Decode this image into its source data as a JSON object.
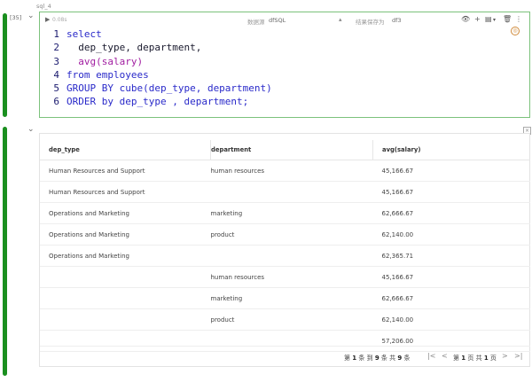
{
  "cell": {
    "label": "sql_4",
    "exec_count": "[35]",
    "duration": "0.08s",
    "datasource_label": "数据源",
    "datasource_value": "dfSQL",
    "save_label": "结果保存为",
    "save_value": "df3"
  },
  "code": {
    "lines": [
      {
        "num": "1",
        "text": "select"
      },
      {
        "num": "2",
        "text": "  dep_type, department,"
      },
      {
        "num": "3",
        "text": "  avg(salary)"
      },
      {
        "num": "4",
        "text": "from employees"
      },
      {
        "num": "5",
        "text": "GROUP BY cube(dep_type, department)"
      },
      {
        "num": "6",
        "text": "ORDER by dep_type , department;"
      }
    ]
  },
  "table": {
    "headers": [
      "dep_type",
      "department",
      "avg(salary)"
    ],
    "rows": [
      [
        "Human Resources and Support",
        "human resources",
        "45,166.67"
      ],
      [
        "Human Resources and Support",
        "",
        "45,166.67"
      ],
      [
        "Operations and Marketing",
        "marketing",
        "62,666.67"
      ],
      [
        "Operations and Marketing",
        "product",
        "62,140.00"
      ],
      [
        "Operations and Marketing",
        "",
        "62,365.71"
      ],
      [
        "",
        "human resources",
        "45,166.67"
      ],
      [
        "",
        "marketing",
        "62,666.67"
      ],
      [
        "",
        "product",
        "62,140.00"
      ],
      [
        "",
        "",
        "57,206.00"
      ]
    ]
  },
  "pager": {
    "p1": "第",
    "p2": "1",
    "p3": "条 到",
    "p4": "9",
    "p5": "条 共",
    "p6": "9",
    "p7": "条",
    "q1": "第",
    "q2": "1",
    "q3": "页 共",
    "q4": "1",
    "q5": "页"
  },
  "colors": {
    "accent": "#1a8f1f",
    "keyword": "#2929c9",
    "function": "#a11da1"
  }
}
